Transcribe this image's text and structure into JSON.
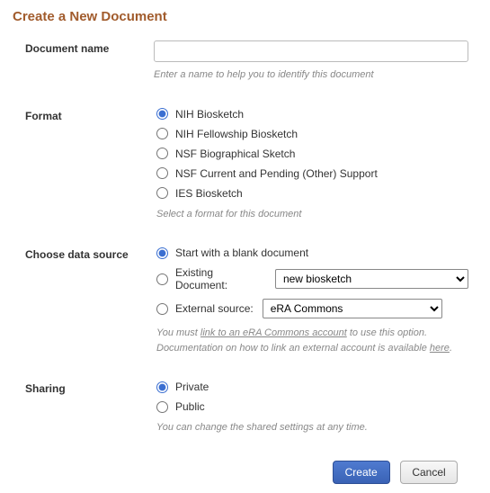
{
  "title": "Create a New Document",
  "doc_name": {
    "label": "Document name",
    "placeholder": "",
    "value": "",
    "hint": "Enter a name to help you to identify this document"
  },
  "format": {
    "label": "Format",
    "options": [
      "NIH Biosketch",
      "NIH Fellowship Biosketch",
      "NSF Biographical Sketch",
      "NSF Current and Pending (Other) Support",
      "IES Biosketch"
    ],
    "selected": 0,
    "hint": "Select a format for this document"
  },
  "data_source": {
    "label": "Choose data source",
    "blank_label": "Start with a blank document",
    "existing_label": "Existing Document:",
    "existing_value": "new biosketch",
    "external_label": "External source:",
    "external_value": "eRA Commons",
    "selected": "blank",
    "hint_prefix": "You must ",
    "hint_link1": "link to an eRA Commons account",
    "hint_mid": " to use this option. Documentation on how to link an external account is available ",
    "hint_link2": "here",
    "hint_suffix": "."
  },
  "sharing": {
    "label": "Sharing",
    "private_label": "Private",
    "public_label": "Public",
    "selected": "private",
    "hint": "You can change the shared settings at any time."
  },
  "buttons": {
    "create": "Create",
    "cancel": "Cancel"
  }
}
